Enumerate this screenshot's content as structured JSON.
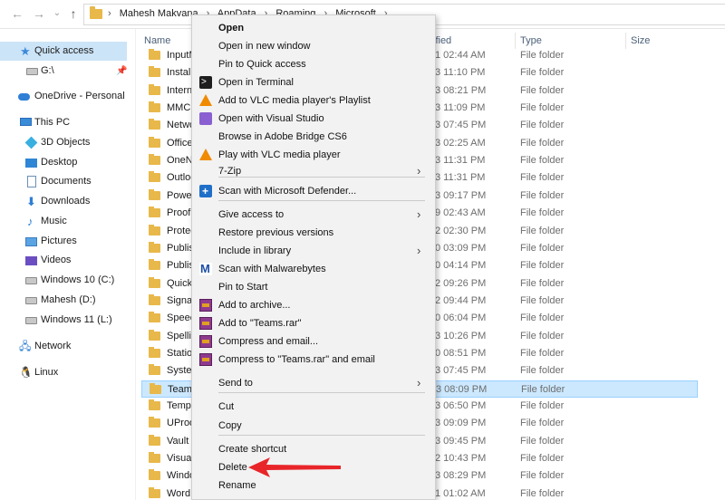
{
  "addressbar": {
    "crumbs": [
      "Mahesh Makvana",
      "AppData",
      "Roaming",
      "Microsoft"
    ]
  },
  "sidebar": {
    "items": [
      {
        "label": "Quick access",
        "icon": "star-icon",
        "selected": true
      },
      {
        "label": "G:\\",
        "icon": "drive-icon",
        "pinned": true
      },
      {
        "label": "OneDrive - Personal",
        "icon": "cloud-icon"
      },
      {
        "label": "This PC",
        "icon": "pc-icon"
      },
      {
        "label": "3D Objects",
        "icon": "cube-icon"
      },
      {
        "label": "Desktop",
        "icon": "desktop-icon"
      },
      {
        "label": "Documents",
        "icon": "document-icon"
      },
      {
        "label": "Downloads",
        "icon": "download-icon"
      },
      {
        "label": "Music",
        "icon": "music-icon"
      },
      {
        "label": "Pictures",
        "icon": "pictures-icon"
      },
      {
        "label": "Videos",
        "icon": "videos-icon"
      },
      {
        "label": "Windows 10 (C:)",
        "icon": "drive-icon"
      },
      {
        "label": "Mahesh (D:)",
        "icon": "drive-icon"
      },
      {
        "label": "Windows 11 (L:)",
        "icon": "drive-icon"
      },
      {
        "label": "Network",
        "icon": "network-icon"
      },
      {
        "label": "Linux",
        "icon": "linux-icon"
      }
    ]
  },
  "columns": {
    "name": "Name",
    "modified": "ified",
    "type": "Type",
    "size": "Size"
  },
  "files": [
    {
      "name": "InputM",
      "modified": "1 02:44 AM",
      "type": "File folder"
    },
    {
      "name": "Installe",
      "modified": "3 11:10 PM",
      "type": "File folder"
    },
    {
      "name": "Interne",
      "modified": "3 08:21 PM",
      "type": "File folder"
    },
    {
      "name": "MMC",
      "modified": "3 11:09 PM",
      "type": "File folder"
    },
    {
      "name": "Netwo",
      "modified": "3 07:45 PM",
      "type": "File folder"
    },
    {
      "name": "Office",
      "modified": "3 02:25 AM",
      "type": "File folder"
    },
    {
      "name": "OneNo",
      "modified": "3 11:31 PM",
      "type": "File folder"
    },
    {
      "name": "Outloo",
      "modified": "3 11:31 PM",
      "type": "File folder"
    },
    {
      "name": "PowerP",
      "modified": "3 09:17 PM",
      "type": "File folder"
    },
    {
      "name": "Proof",
      "modified": "9 02:43 AM",
      "type": "File folder"
    },
    {
      "name": "Protect",
      "modified": "2 02:30 PM",
      "type": "File folder"
    },
    {
      "name": "Publish",
      "modified": "0 03:09 PM",
      "type": "File folder"
    },
    {
      "name": "Publish",
      "modified": "0 04:14 PM",
      "type": "File folder"
    },
    {
      "name": "QuickS",
      "modified": "2 09:26 PM",
      "type": "File folder"
    },
    {
      "name": "Signatu",
      "modified": "2 09:44 PM",
      "type": "File folder"
    },
    {
      "name": "Speech",
      "modified": "0 06:04 PM",
      "type": "File folder"
    },
    {
      "name": "Spelling",
      "modified": "3 10:26 PM",
      "type": "File folder"
    },
    {
      "name": "Station",
      "modified": "0 08:51 PM",
      "type": "File folder"
    },
    {
      "name": "System",
      "modified": "3 07:45 PM",
      "type": "File folder"
    },
    {
      "name": "Teams",
      "modified": "3 08:09 PM",
      "type": "File folder",
      "selected": true
    },
    {
      "name": "Templa",
      "modified": "3 06:50 PM",
      "type": "File folder"
    },
    {
      "name": "UProof",
      "modified": "3 09:09 PM",
      "type": "File folder"
    },
    {
      "name": "Vault",
      "modified": "3 09:45 PM",
      "type": "File folder"
    },
    {
      "name": "VisualS",
      "modified": "2 10:43 PM",
      "type": "File folder"
    },
    {
      "name": "Windo",
      "modified": "3 08:29 PM",
      "type": "File folder"
    },
    {
      "name": "Word",
      "modified": "1 01:02 AM",
      "type": "File folder"
    }
  ],
  "context_menu": {
    "items": [
      {
        "label": "Open",
        "bold": true
      },
      {
        "label": "Open in new window"
      },
      {
        "label": "Pin to Quick access"
      },
      {
        "label": "Open in Terminal",
        "icon": "terminal-icon"
      },
      {
        "label": "Add to VLC media player's Playlist",
        "icon": "vlc-icon"
      },
      {
        "label": "Open with Visual Studio",
        "icon": "visual-studio-icon"
      },
      {
        "label": "Browse in Adobe Bridge CS6"
      },
      {
        "label": "Play with VLC media player",
        "icon": "vlc-icon"
      },
      {
        "label": "7-Zip",
        "submenu": true
      },
      {
        "label": "Scan with Microsoft Defender...",
        "icon": "defender-icon"
      },
      {
        "label": "Give access to",
        "submenu": true
      },
      {
        "label": "Restore previous versions"
      },
      {
        "label": "Include in library",
        "submenu": true
      },
      {
        "label": "Scan with Malwarebytes",
        "icon": "malwarebytes-icon"
      },
      {
        "label": "Pin to Start"
      },
      {
        "label": "Add to archive...",
        "icon": "winrar-icon"
      },
      {
        "label": "Add to \"Teams.rar\"",
        "icon": "winrar-icon"
      },
      {
        "label": "Compress and email...",
        "icon": "winrar-icon"
      },
      {
        "label": "Compress to \"Teams.rar\" and email",
        "icon": "winrar-icon"
      },
      {
        "label": "Send to",
        "submenu": true
      },
      {
        "label": "Cut"
      },
      {
        "label": "Copy"
      },
      {
        "label": "Create shortcut"
      },
      {
        "label": "Delete"
      },
      {
        "label": "Rename"
      }
    ]
  },
  "colors": {
    "selection": "#cce8ff",
    "folder": "#e8b84a",
    "annotation_arrow": "#e8262a"
  }
}
